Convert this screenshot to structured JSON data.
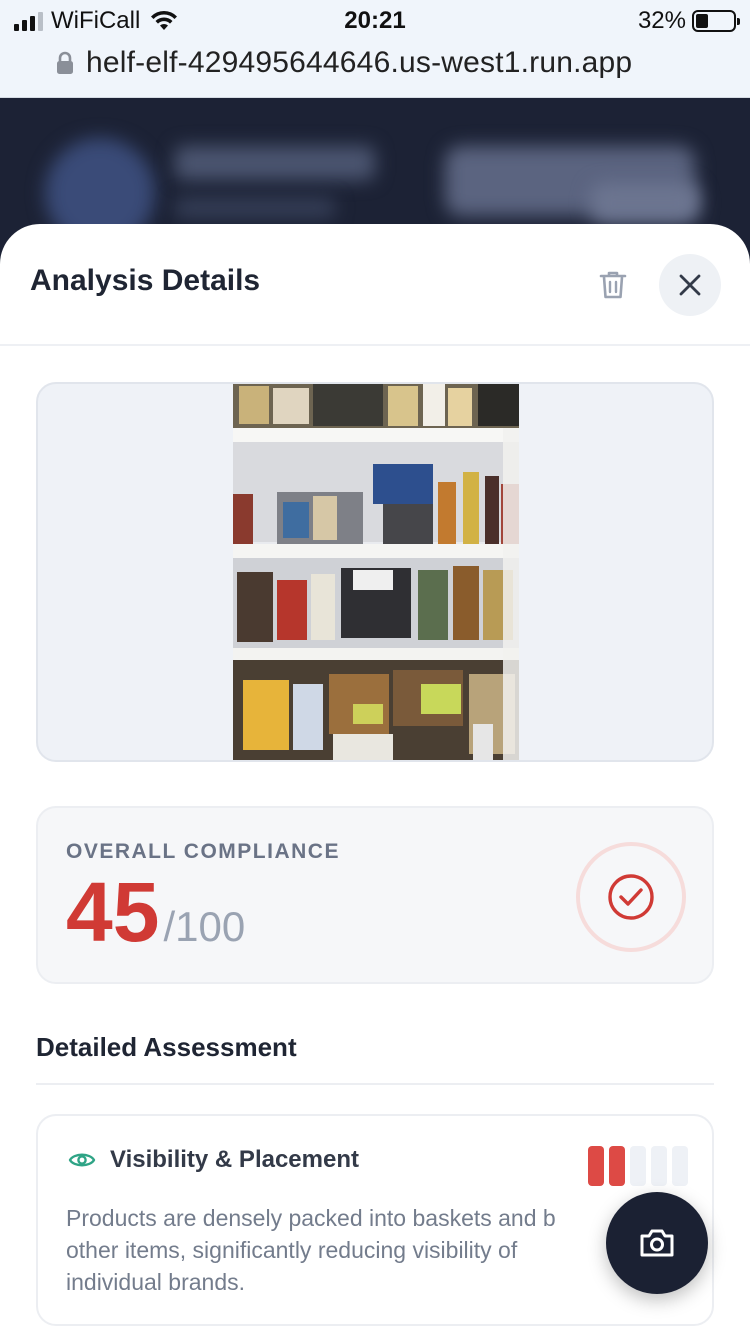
{
  "status_bar": {
    "carrier": "WiFiCall",
    "time": "20:21",
    "battery_percent": "32%",
    "battery_level": 0.32
  },
  "browser": {
    "url": "helf-elf-429495644646.us-west1.run.app"
  },
  "sheet": {
    "title": "Analysis Details",
    "delete_icon": "trash-icon",
    "close_icon": "close-icon"
  },
  "score": {
    "label": "OVERALL COMPLIANCE",
    "value": "45",
    "max": "/100",
    "icon": "check-circle-icon",
    "color": "#d03a35"
  },
  "assessment": {
    "section_title": "Detailed Assessment",
    "items": [
      {
        "icon": "eye-icon",
        "name": "Visibility & Placement",
        "rating": 2,
        "rating_max": 5,
        "description_lines": [
          "Products are densely packed into baskets and b",
          "other items, significantly reducing visibility of",
          "individual brands."
        ]
      }
    ]
  },
  "fab": {
    "icon": "camera-icon"
  }
}
